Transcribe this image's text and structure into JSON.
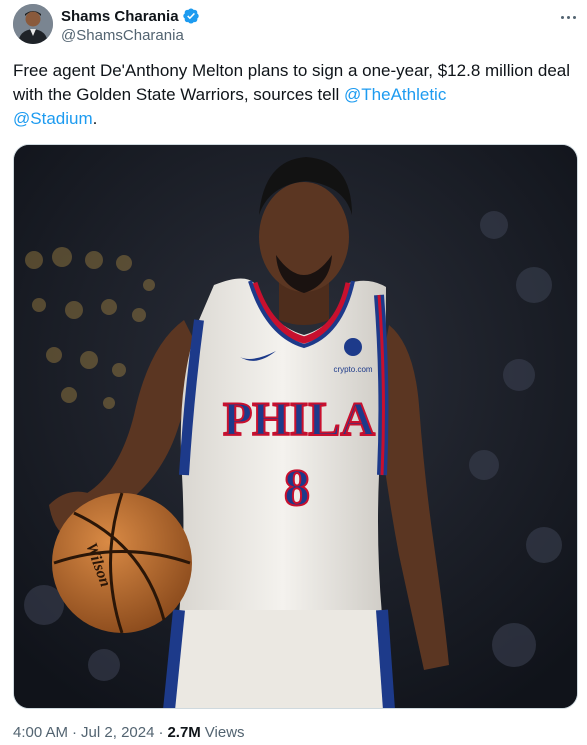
{
  "author": {
    "display_name": "Shams Charania",
    "handle": "@ShamsCharania",
    "verified_icon": "verified-badge-icon",
    "avatar_icon": "profile-avatar"
  },
  "tweet": {
    "text_part1": "Free agent De'Anthony Melton plans to sign a one-year, $12.8 million deal with the Golden State Warriors, sources tell ",
    "mention1": "@TheAthletic",
    "mention2": "@Stadium",
    "text_end": "."
  },
  "media": {
    "jersey_text": "PHILA",
    "jersey_number": "8",
    "sponsor_text": "crypto.com",
    "ball_brand": "Wilson"
  },
  "meta": {
    "time": "4:00 AM",
    "separator": "·",
    "date": "Jul 2, 2024",
    "views_count": "2.7M",
    "views_label": "Views"
  },
  "colors": {
    "accent": "#1d9bf0",
    "text": "#0f1419",
    "muted": "#536471",
    "sixers_blue": "#1d3a8a",
    "sixers_red": "#c8102e"
  }
}
